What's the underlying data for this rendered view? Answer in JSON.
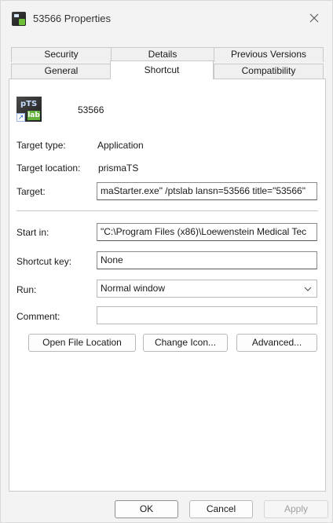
{
  "window": {
    "title": "53566 Properties"
  },
  "tabs": [
    {
      "label": "Security"
    },
    {
      "label": "Details"
    },
    {
      "label": "Previous Versions"
    },
    {
      "label": "General"
    },
    {
      "label": "Shortcut"
    },
    {
      "label": "Compatibility"
    }
  ],
  "active_tab": "Shortcut",
  "shortcut": {
    "icon_text": "pTS",
    "icon_badge": "lab",
    "name": "53566",
    "target_type_label": "Target type:",
    "target_type_value": "Application",
    "target_location_label": "Target location:",
    "target_location_value": "prismaTS",
    "target_label": "Target:",
    "target_value": "maStarter.exe\" /ptslab lansn=53566 title=\"53566\"",
    "start_in_label": "Start in:",
    "start_in_value": "\"C:\\Program Files (x86)\\Loewenstein Medical Tec",
    "shortcut_key_label": "Shortcut key:",
    "shortcut_key_value": "None",
    "run_label": "Run:",
    "run_value": "Normal window",
    "comment_label": "Comment:",
    "comment_value": ""
  },
  "buttons": {
    "open_file_location": "Open File Location",
    "change_icon": "Change Icon...",
    "advanced": "Advanced...",
    "ok": "OK",
    "cancel": "Cancel",
    "apply": "Apply"
  },
  "icons": {
    "close": "close-icon",
    "dropdown": "chevron-down-icon",
    "shortcut_overlay": "shortcut-arrow-icon"
  }
}
